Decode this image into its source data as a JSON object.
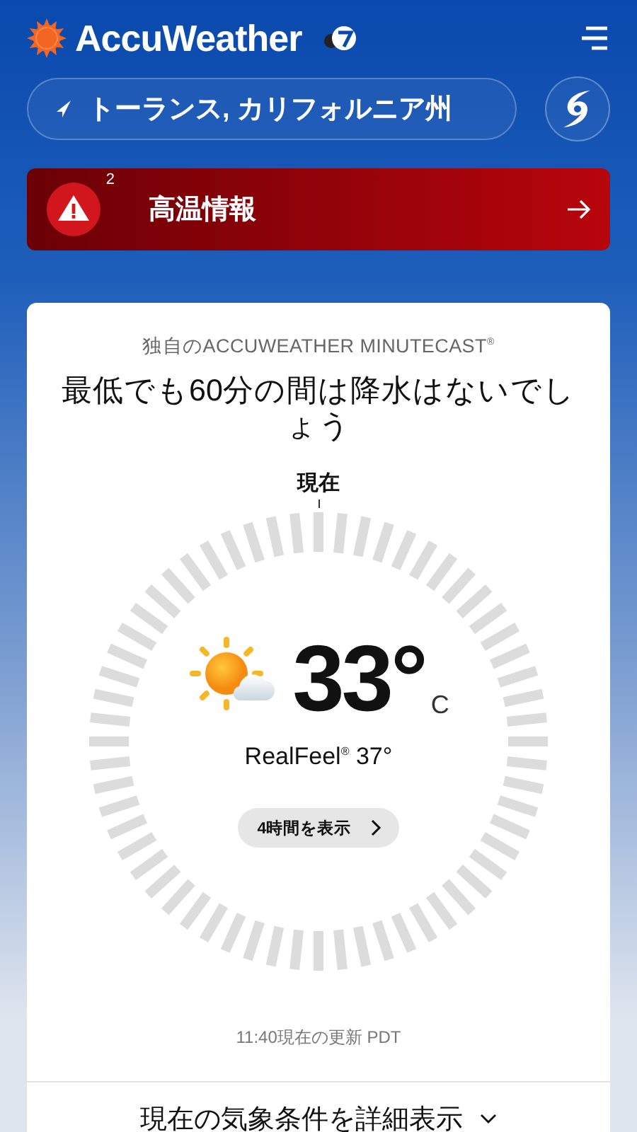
{
  "header": {
    "brand": "AccuWeather"
  },
  "location": {
    "name": "トーランス, カリフォルニア州"
  },
  "alert": {
    "title": "高温情報",
    "count": "2"
  },
  "minutecast": {
    "label": "独自のACCUWEATHER MINUTECAST$^{®}$",
    "headline": "最低でも60分の間は降水はないでしょう",
    "now_label": "現在",
    "temperature": "33°",
    "unit": "C",
    "realfeel": "RealFeel$^{®}$ 37°",
    "hours_button": "4時間を表示",
    "updated": "11:40現在の更新 PDT",
    "details_button": "現在の気象条件を詳細表示"
  }
}
